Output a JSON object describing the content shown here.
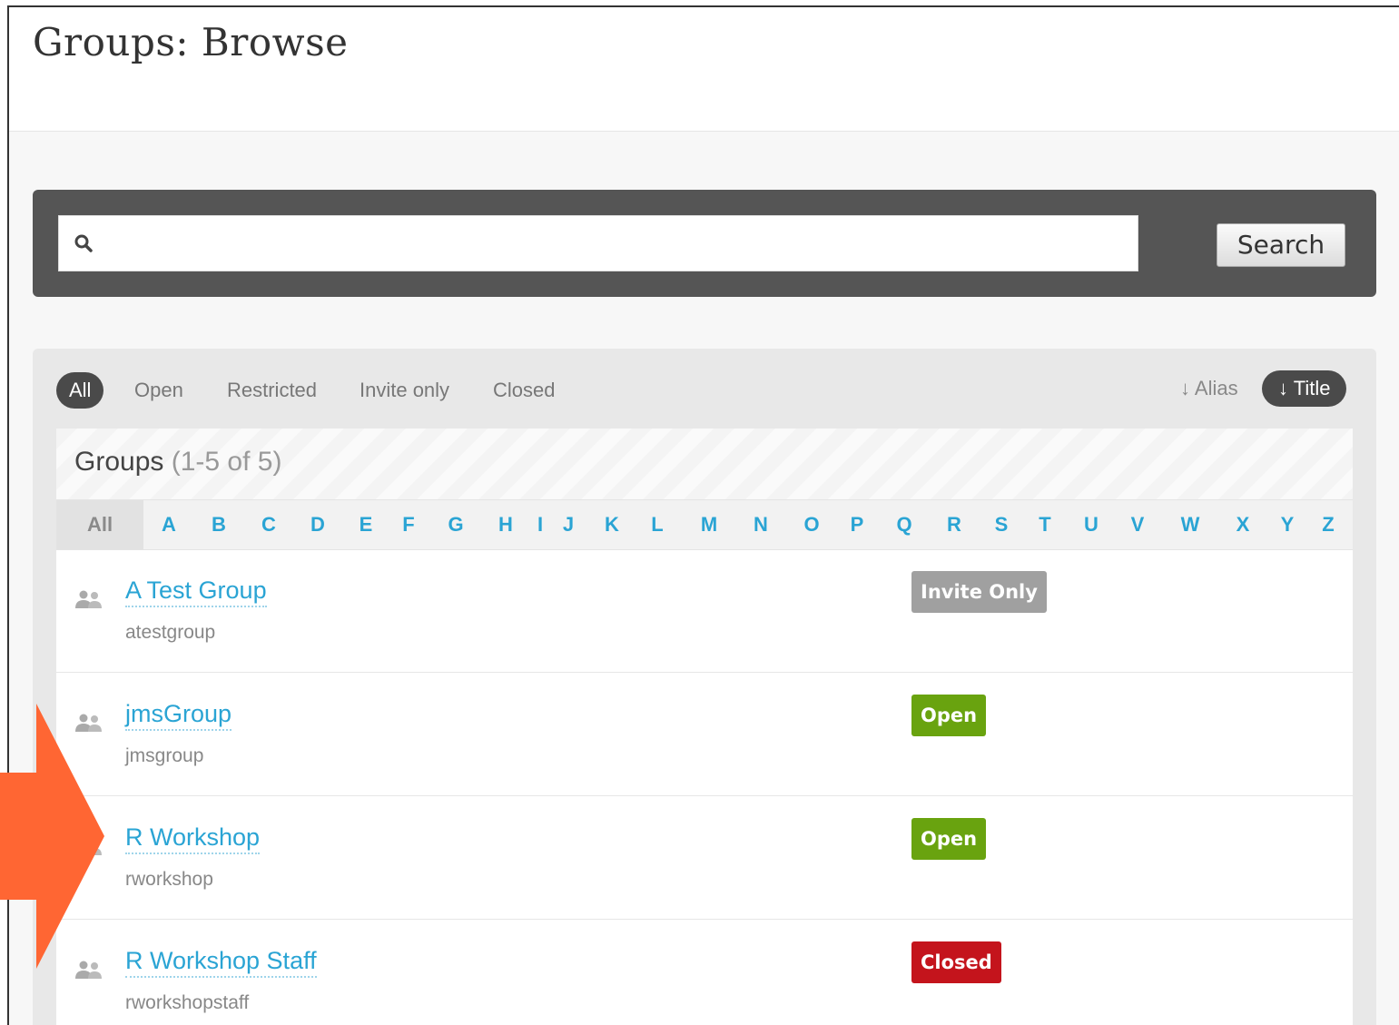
{
  "header": {
    "title": "Groups: Browse"
  },
  "search": {
    "placeholder": "",
    "value": "",
    "button_label": "Search"
  },
  "filters": {
    "items": [
      "All",
      "Open",
      "Restricted",
      "Invite only",
      "Closed"
    ],
    "active": "All"
  },
  "sort": {
    "items": [
      "↓ Alias",
      "↓ Title"
    ],
    "active": "↓ Title"
  },
  "list": {
    "title": "Groups",
    "count": "(1-5 of 5)",
    "alpha_all": "All",
    "letters": [
      "A",
      "B",
      "C",
      "D",
      "E",
      "F",
      "G",
      "H",
      "I",
      "J",
      "K",
      "L",
      "M",
      "N",
      "O",
      "P",
      "Q",
      "R",
      "S",
      "T",
      "U",
      "V",
      "W",
      "X",
      "Y",
      "Z"
    ]
  },
  "groups": [
    {
      "name": "A Test Group",
      "alias": "atestgroup",
      "status": "Invite Only",
      "status_color": "#a0a0a0"
    },
    {
      "name": "jmsGroup",
      "alias": "jmsgroup",
      "status": "Open",
      "status_color": "#69a30f"
    },
    {
      "name": "R Workshop",
      "alias": "rworkshop",
      "status": "Open",
      "status_color": "#69a30f"
    },
    {
      "name": "R Workshop Staff",
      "alias": "rworkshopstaff",
      "status": "Closed",
      "status_color": "#c4141c"
    }
  ],
  "colors": {
    "accent": "#2aa4d4",
    "arrow": "#ff6633",
    "searchbar": "#555555"
  },
  "annotation": {
    "icon": "arrow-right-icon"
  }
}
